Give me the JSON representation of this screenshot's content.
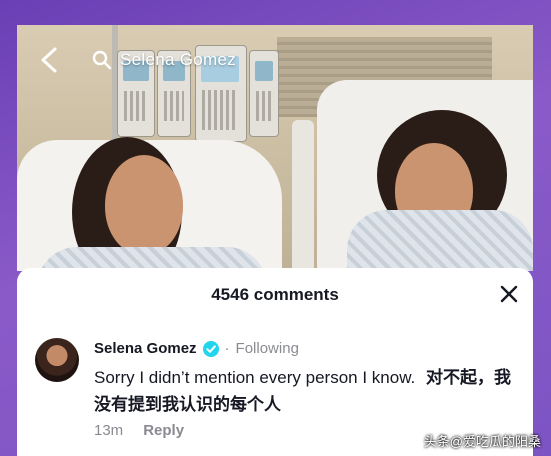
{
  "header": {
    "search_text": "Selena Gomez"
  },
  "sheet": {
    "comments_count": "4546 comments"
  },
  "comment": {
    "author": "Selena Gomez",
    "separator": "·",
    "following_label": "Following",
    "text_en": "Sorry I didn’t mention every person I know.",
    "text_cn": "对不起，我没有提到我认识的每个人",
    "time": "13m",
    "reply_label": "Reply"
  },
  "watermark": {
    "text": "头条@爱吃瓜的阳桑"
  },
  "colors": {
    "frame": "#7a4fc0",
    "verified": "#20d5ec",
    "text_primary": "#161823",
    "text_secondary": "#8a8b91"
  },
  "icons": {
    "back": "back-arrow-icon",
    "search": "search-icon",
    "close": "close-icon",
    "verified": "verified-badge-icon"
  }
}
